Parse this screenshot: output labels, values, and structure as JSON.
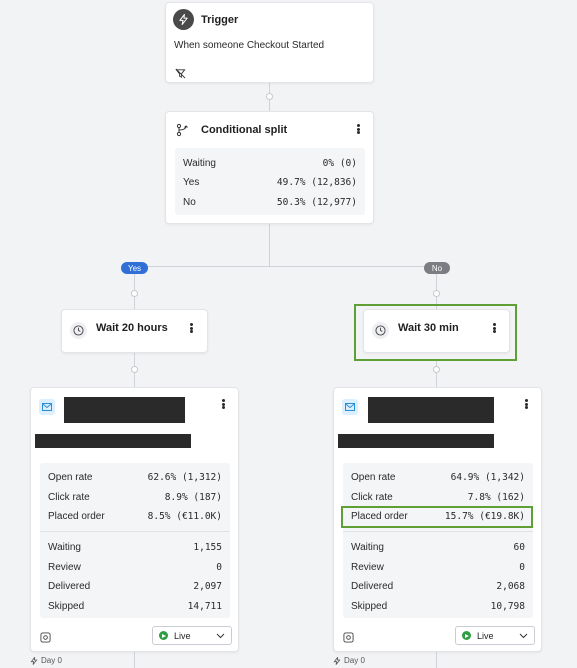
{
  "colors": {
    "canvas_bg": "#f2f3f5",
    "connector": "#cfd2d8",
    "yes_pill": "#2f6fd6",
    "no_pill": "#7b7d82",
    "email_icon_bg": "#dcefff",
    "email_icon": "#2b8fd8",
    "highlight": "#5fa036",
    "live": "#2e9e44"
  },
  "trigger": {
    "icon": "lightning-icon",
    "title": "Trigger",
    "description": "When someone Checkout Started",
    "footer_icon": "filter-off-icon"
  },
  "split": {
    "icon": "split-icon",
    "title": "Conditional split",
    "rows": [
      {
        "label": "Waiting",
        "value": "0% (0)"
      },
      {
        "label": "Yes",
        "value": "49.7% (12,836)"
      },
      {
        "label": "No",
        "value": "50.3% (12,977)"
      }
    ]
  },
  "branches": {
    "yes_label": "Yes",
    "no_label": "No"
  },
  "wait_left": {
    "icon": "clock-icon",
    "title": "Wait 20 hours"
  },
  "wait_right": {
    "icon": "clock-icon",
    "title": "Wait 30 min"
  },
  "email_left": {
    "icon": "email-icon",
    "metrics": [
      {
        "label": "Open rate",
        "value": "62.6% (1,312)"
      },
      {
        "label": "Click rate",
        "value": "8.9% (187)"
      },
      {
        "label": "Placed order",
        "value": "8.5% (€11.0K)"
      }
    ],
    "counts": [
      {
        "label": "Waiting",
        "value": "1,155"
      },
      {
        "label": "Review",
        "value": "0"
      },
      {
        "label": "Delivered",
        "value": "2,097"
      },
      {
        "label": "Skipped",
        "value": "14,711"
      }
    ],
    "status": "Live",
    "footer_icon": "analytics-icon"
  },
  "email_right": {
    "icon": "email-icon",
    "metrics": [
      {
        "label": "Open rate",
        "value": "64.9% (1,342)"
      },
      {
        "label": "Click rate",
        "value": "7.8% (162)"
      },
      {
        "label": "Placed order",
        "value": "15.7% (€19.8K)"
      }
    ],
    "counts": [
      {
        "label": "Waiting",
        "value": "60"
      },
      {
        "label": "Review",
        "value": "0"
      },
      {
        "label": "Delivered",
        "value": "2,068"
      },
      {
        "label": "Skipped",
        "value": "10,798"
      }
    ],
    "status": "Live",
    "footer_icon": "analytics-icon"
  },
  "footer": {
    "left_day": "Day 0",
    "right_day": "Day 0"
  }
}
